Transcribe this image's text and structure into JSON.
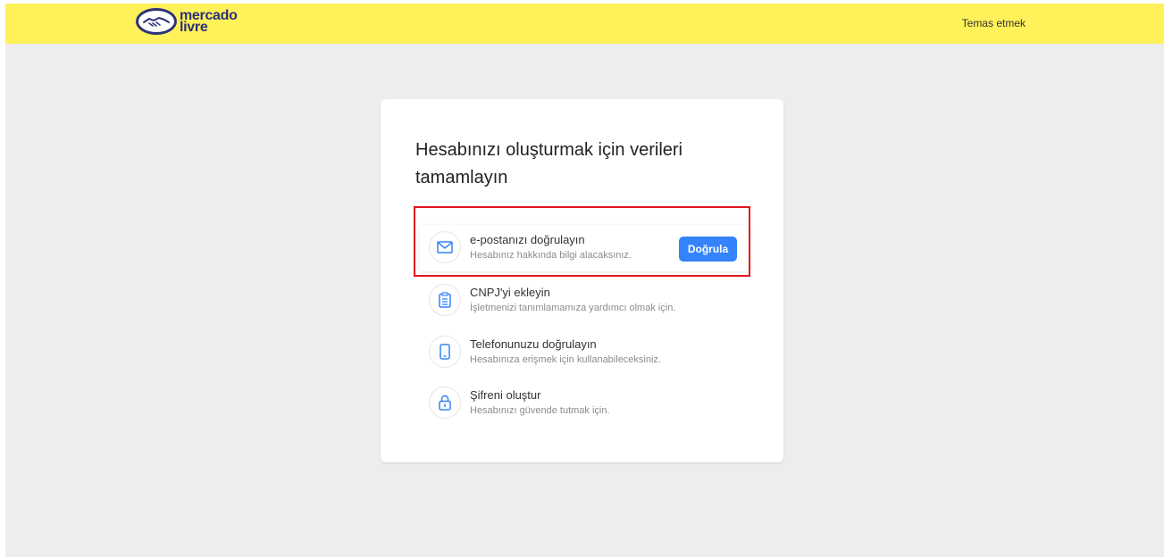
{
  "header": {
    "logo_line1": "mercado",
    "logo_line2": "livre",
    "contact_label": "Temas etmek"
  },
  "card": {
    "title": "Hesabınızı oluşturmak için verileri tamamlayın",
    "steps": [
      {
        "title": "e-postanızı doğrulayın",
        "description": "Hesabınız hakkında bilgi alacaksınız.",
        "icon": "envelope-icon",
        "action_label": "Doğrula"
      },
      {
        "title": "CNPJ'yi ekleyin",
        "description": "İşletmenizi tanımlamamıza yardımcı olmak için.",
        "icon": "clipboard-icon"
      },
      {
        "title": "Telefonunuzu doğrulayın",
        "description": "Hesabınıza erişmek için kullanabileceksiniz.",
        "icon": "phone-icon"
      },
      {
        "title": "Şifreni oluştur",
        "description": "Hesabınızı güvende tutmak için.",
        "icon": "lock-icon"
      }
    ]
  },
  "colors": {
    "header_bg": "#fff159",
    "page_bg": "#ededed",
    "primary_button": "#3483fa",
    "highlight_border": "#e0171e",
    "icon_blue": "#3483fa",
    "logo_navy": "#2d3277"
  }
}
